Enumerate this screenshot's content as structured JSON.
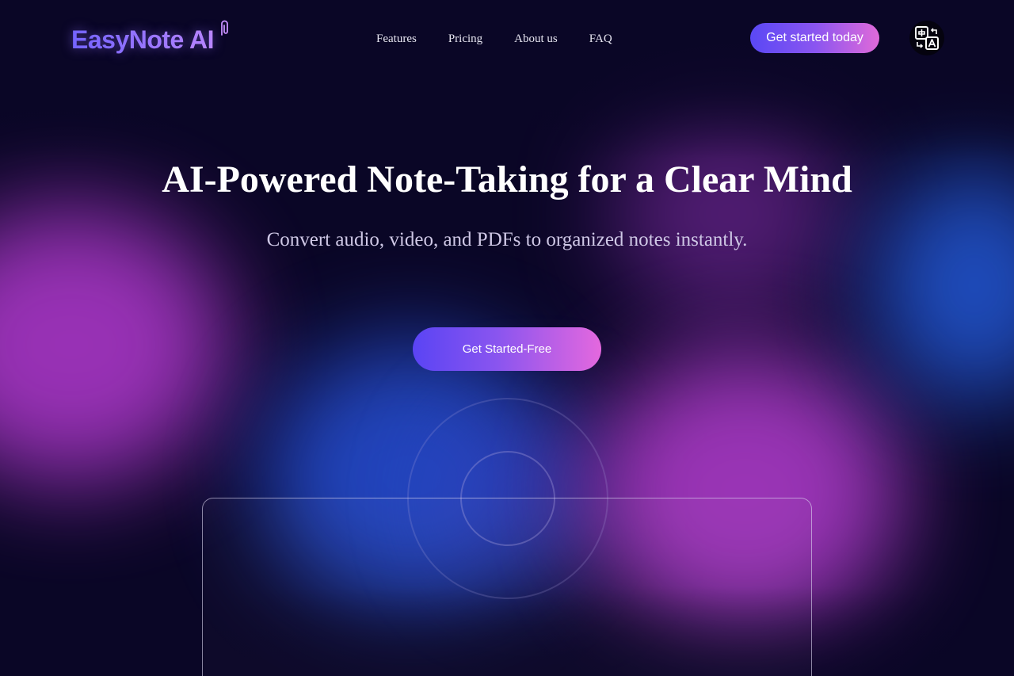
{
  "header": {
    "logo_text": "EasyNote AI",
    "nav": [
      {
        "label": "Features"
      },
      {
        "label": "Pricing"
      },
      {
        "label": "About us"
      },
      {
        "label": "FAQ"
      }
    ],
    "cta_label": "Get started today",
    "language_icon": "translate-icon"
  },
  "hero": {
    "title": "AI-Powered Note-Taking for a Clear Mind",
    "subtitle": "Convert audio, video, and PDFs to organized notes instantly.",
    "cta_label": "Get Started-Free"
  },
  "colors": {
    "background": "#0a0626",
    "accent_start": "#5a44f4",
    "accent_end": "#e468de",
    "blob_purple": "#a034bd",
    "blob_blue": "#2348c4"
  }
}
